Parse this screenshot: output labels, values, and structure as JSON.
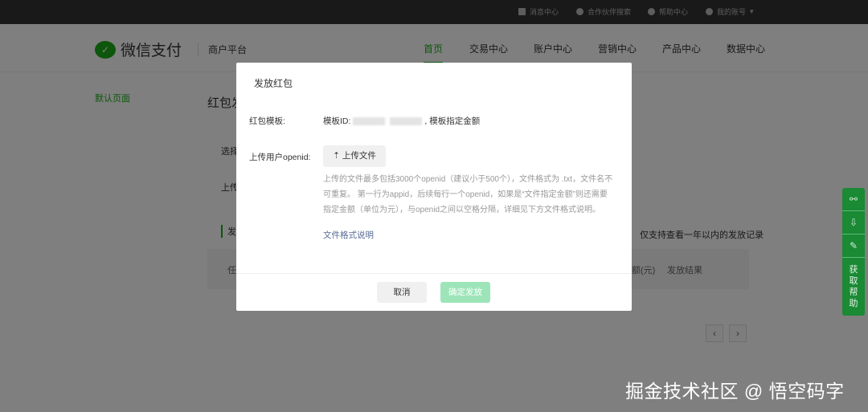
{
  "topbar": {
    "items": [
      "消息中心",
      "合作伙伴搜索",
      "帮助中心",
      "我的账号"
    ]
  },
  "header": {
    "brand": "微信支付",
    "sub": "商户平台",
    "nav": [
      "首页",
      "交易中心",
      "账户中心",
      "营销中心",
      "产品中心",
      "数据中心"
    ]
  },
  "sidebar": {
    "item": "默认页面"
  },
  "page": {
    "title": "红包发",
    "row1": "选择",
    "row2": "上传",
    "section": "发",
    "note": "仅支持查看一年以内的发放记录",
    "col_first": "任",
    "col_amount": "额(元)",
    "col_result": "发放结果",
    "prev": "‹",
    "next": "›"
  },
  "modal": {
    "title": "发放红包",
    "template_label": "红包模板:",
    "template_prefix": "模板ID:",
    "template_suffix": ", 模板指定金额",
    "upload_label": "上传用户openid:",
    "upload_btn": "上传文件",
    "hint": "上传的文件最多包括3000个openid（建议小于500个），文件格式为 .txt，文件名不可重复。 第一行为appid，后续每行一个openid，如果是“文件指定金额”则还需要指定金额（单位为元），与openid之间以空格分隔，详细见下方文件格式说明。",
    "link": "文件格式说明",
    "cancel": "取消",
    "confirm": "确定发放"
  },
  "float": {
    "help": "获取帮助"
  },
  "watermark": "掘金技术社区 @ 悟空码字"
}
